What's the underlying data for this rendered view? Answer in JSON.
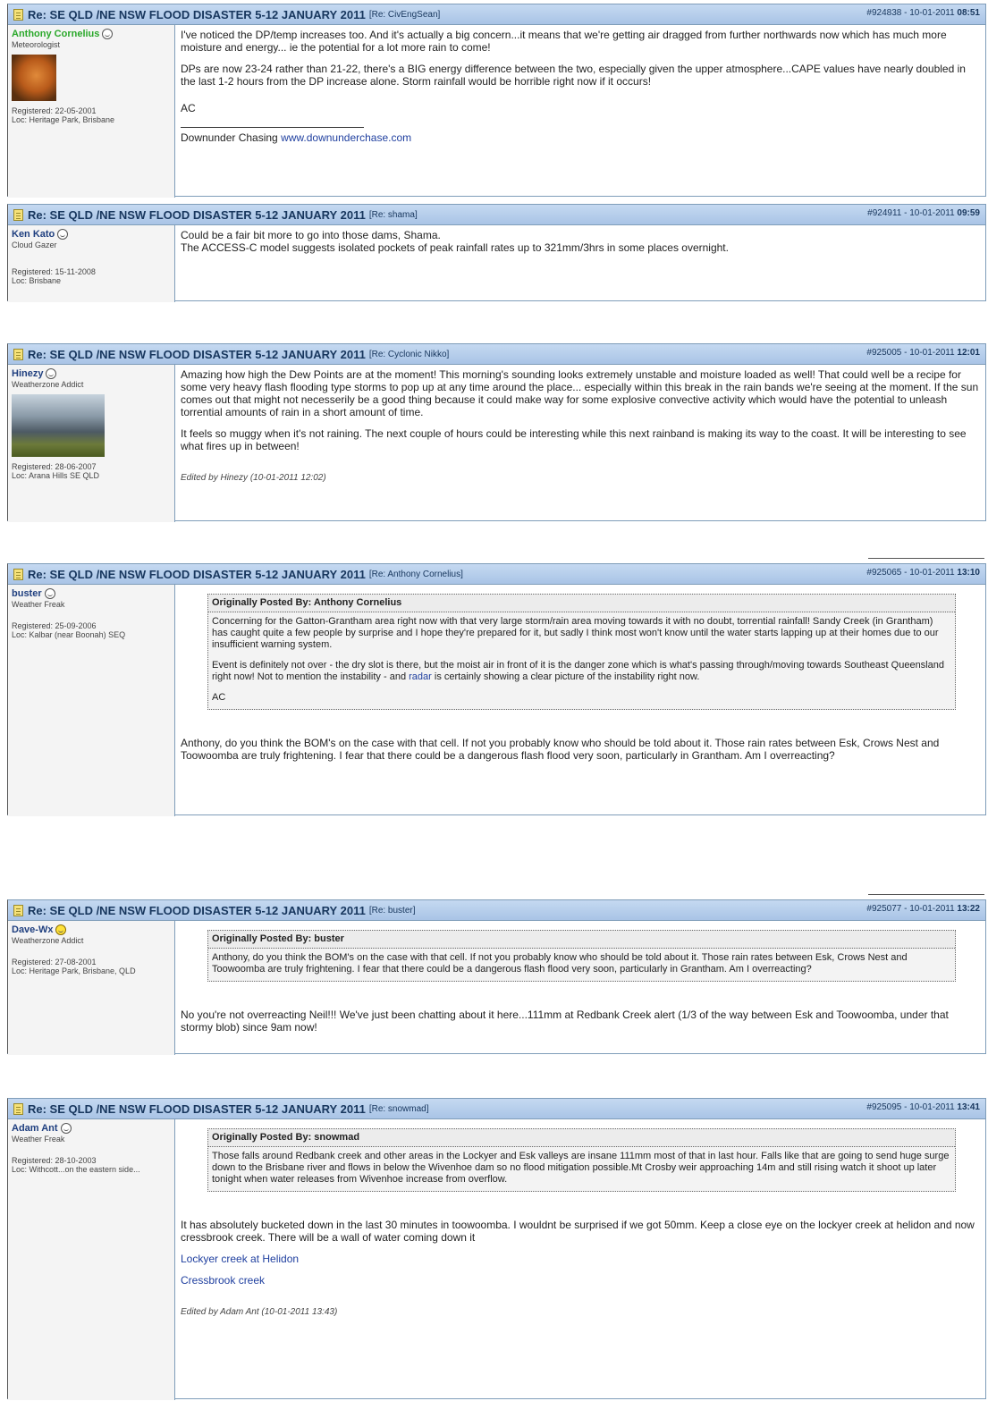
{
  "thread_title": "Re: SE QLD /NE NSW FLOOD DISASTER 5-12 JANUARY 2011",
  "posts": [
    {
      "re": "[Re: CivEngSean]",
      "id": "#924838 - 10-01-2011",
      "time": "08:51",
      "user": "Anthony Cornelius",
      "rank": "Meteorologist",
      "registered": "Registered: 22-05-2001",
      "loc": "Loc: Heritage Park, Brisbane",
      "p1": "I've noticed the DP/temp increases too. And it's actually a big concern...it means that we're getting air dragged from further northwards now which has much more moisture and energy... ie the potential for a lot more rain to come!",
      "p2": "DPs are now 23-24 rather than 21-22, there's a BIG energy difference between the two, especially given the upper atmosphere...CAPE values have nearly doubled in the last 1-2 hours from the DP increase alone. Storm rainfall would be horrible right now if it occurs!",
      "p3": "AC",
      "sig_text": "Downunder Chasing ",
      "sig_link": "www.downunderchase.com"
    },
    {
      "re": "[Re: shama]",
      "id": "#924911 - 10-01-2011",
      "time": "09:59",
      "user": "Ken Kato",
      "rank": "Cloud Gazer",
      "registered": "Registered: 15-11-2008",
      "loc": "Loc: Brisbane",
      "p1": "Could be a fair bit more to go into those dams, Shama.",
      "p2": "The ACCESS-C model suggests isolated pockets of peak rainfall rates up to 321mm/3hrs in some places overnight."
    },
    {
      "re": "[Re: Cyclonic Nikko]",
      "id": "#925005 - 10-01-2011",
      "time": "12:01",
      "user": "Hinezy",
      "rank": "Weatherzone Addict",
      "registered": "Registered: 28-06-2007",
      "loc": "Loc: Arana Hills SE QLD",
      "p1": "Amazing how high the Dew Points are at the moment! This morning's sounding looks extremely unstable and moisture loaded as well! That could well be a recipe for some very heavy flash flooding type storms to pop up at any time around the place... especially within this break in the rain bands we're seeing at the moment. If the sun comes out that might not necesserily be a good thing because it could make way for some explosive convective activity which would have the potential to unleash torrential amounts of rain in a short amount of time.",
      "p2": "It feels so muggy when it's not raining. The next couple of hours could be interesting while this next rainband is making its way to the coast. It will be interesting to see what fires up in between!",
      "edited": "Edited by Hinezy (10-01-2011 12:02)"
    },
    {
      "re": "[Re: Anthony Cornelius]",
      "id": "#925065 - 10-01-2011",
      "time": "13:10",
      "user": "buster",
      "rank": "Weather Freak",
      "registered": "Registered: 25-09-2006",
      "loc": "Loc: Kalbar (near Boonah) SEQ",
      "quote_head": "Originally Posted By: Anthony Cornelius",
      "q1": "Concerning for the Gatton-Grantham area right now with that very large storm/rain area moving towards it with no doubt, torrential rainfall! Sandy Creek (in Grantham) has caught quite a few people by surprise and I hope they're prepared for it, but sadly I think most won't know until the water starts lapping up at their homes due to our insufficient warning system.",
      "q2a": "Event is definitely not over - the dry slot is there, but the moist air in front of it is the danger zone which is what's passing through/moving towards Southeast Queensland right now! Not to mention the instability - and ",
      "q2link": "radar",
      "q2b": " is certainly showing a clear picture of the instability right now.",
      "q3": "AC",
      "p1": "Anthony, do you think the BOM's on the case with that cell. If not you probably know who should be told about it. Those rain rates between Esk, Crows Nest and Toowoomba are truly frightening. I fear that there could be a dangerous flash flood very soon, particularly in Grantham. Am I overreacting?"
    },
    {
      "re": "[Re: buster]",
      "id": "#925077 - 10-01-2011",
      "time": "13:22",
      "user": "Dave-Wx",
      "rank": "Weatherzone Addict",
      "registered": "Registered: 27-08-2001",
      "loc": "Loc: Heritage Park, Brisbane, QLD",
      "quote_head": "Originally Posted By: buster",
      "q1": "Anthony, do you think the BOM's on the case with that cell. If not you probably know who should be told about it. Those rain rates between Esk, Crows Nest and Toowoomba are truly frightening. I fear that there could be a dangerous flash flood very soon, particularly in Grantham. Am I overreacting?",
      "p1": "No you're not overreacting Neil!!! We've just been chatting about it here...111mm at Redbank Creek alert (1/3 of the way between Esk and Toowoomba, under that stormy blob) since 9am now!"
    },
    {
      "re": "[Re: snowmad]",
      "id": "#925095 - 10-01-2011",
      "time": "13:41",
      "user": "Adam Ant",
      "rank": "Weather Freak",
      "registered": "Registered: 28-10-2003",
      "loc": "Loc: Withcott...on the eastern side...",
      "quote_head": "Originally Posted By: snowmad",
      "q1": "Those falls around Redbank creek and other areas in the Lockyer and Esk valleys are insane 111mm most of that in last hour. Falls like that are going to send huge surge down to the Brisbane river and flows in below the Wivenhoe dam so no flood mitigation possible.Mt Crosby weir approaching 14m and still rising watch it shoot up later tonight when water releases from Wivenhoe increase from overflow.",
      "p1": "It has absolutely bucketed down in the last 30 minutes in toowoomba. I wouldnt be surprised if we got 50mm. Keep a close eye on the lockyer creek at helidon and now cressbrook creek. There will be a wall of water coming down it",
      "link1": "Lockyer creek at Helidon",
      "link2": "Cressbrook creek",
      "edited": "Edited by Adam Ant (10-01-2011 13:43)"
    }
  ]
}
